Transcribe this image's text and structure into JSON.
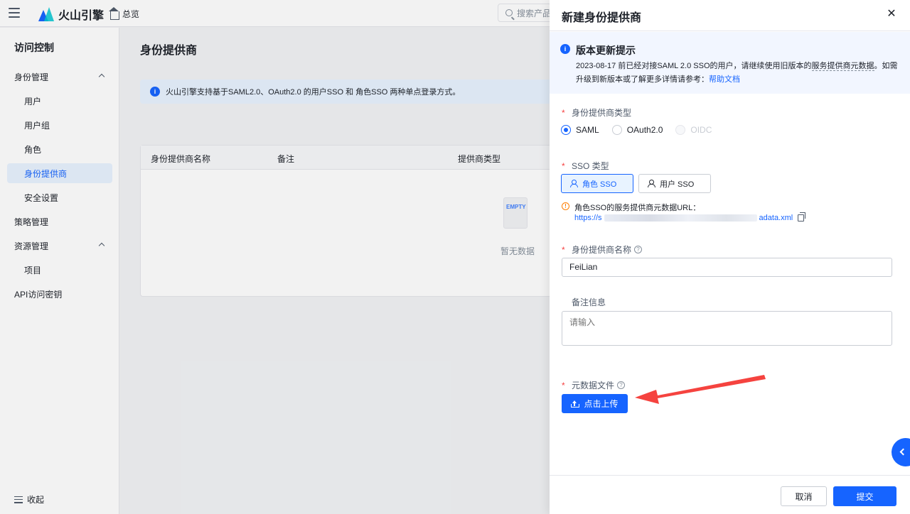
{
  "topbar": {
    "brand": "火山引擎",
    "home_label": "总览",
    "search_placeholder": "搜索产品"
  },
  "sidebar": {
    "title": "访问控制",
    "items": [
      {
        "label": "身份管理"
      },
      {
        "label": "用户"
      },
      {
        "label": "用户组"
      },
      {
        "label": "角色"
      },
      {
        "label": "身份提供商"
      },
      {
        "label": "安全设置"
      },
      {
        "label": "策略管理"
      },
      {
        "label": "资源管理"
      },
      {
        "label": "项目"
      },
      {
        "label": "API访问密钥"
      }
    ],
    "collapse_label": "收起"
  },
  "main": {
    "title": "身份提供商",
    "info_text": "火山引擎支持基于SAML2.0、OAuth2.0 的用户SSO 和 角色SSO 两种单点登录方式。",
    "columns": [
      "身份提供商名称",
      "备注",
      "提供商类型"
    ],
    "empty_badge": "EMPTY",
    "empty_text": "暂无数据"
  },
  "drawer": {
    "title": "新建身份提供商",
    "notice": {
      "title": "版本更新提示",
      "text_before": "2023-08-17 前已经对接SAML 2.0 SSO的用户，请继续使用旧版本的",
      "text_underlined": "服务提供商元数据",
      "text_after": "。如需升级到新版本或了解更多详情请参考：",
      "link": "帮助文档"
    },
    "provider_type": {
      "label": "身份提供商类型",
      "options": [
        "SAML",
        "OAuth2.0",
        "OIDC"
      ],
      "selected": "SAML"
    },
    "sso_type": {
      "label": "SSO 类型",
      "options": [
        "角色 SSO",
        "用户 SSO"
      ],
      "selected": "角色 SSO"
    },
    "metadata_url": {
      "title": "角色SSO的服务提供商元数据URL：",
      "prefix": "https://s",
      "suffix": "adata.xml"
    },
    "name_field": {
      "label": "身份提供商名称",
      "value": "FeiLian"
    },
    "remark_field": {
      "label": "备注信息",
      "placeholder": "请输入"
    },
    "metadata_file": {
      "label": "元数据文件",
      "button": "点击上传"
    },
    "footer": {
      "cancel": "取消",
      "submit": "提交"
    }
  },
  "colors": {
    "primary": "#1664ff",
    "annotation_arrow": "#f5433f",
    "required": "#f53f3f",
    "warning": "#ff7d00"
  }
}
